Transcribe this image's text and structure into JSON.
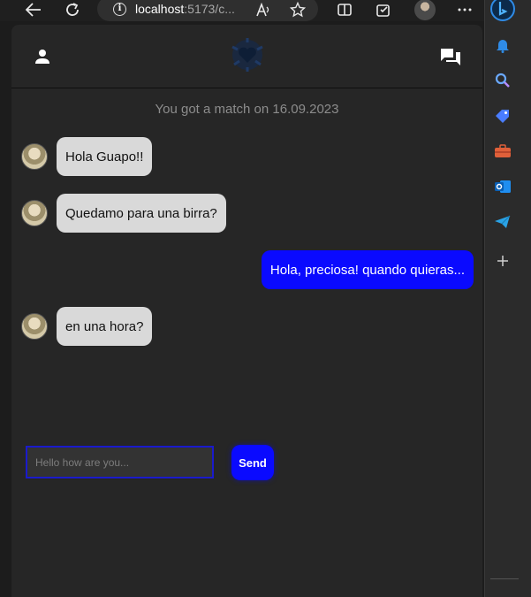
{
  "browser": {
    "address_host": "localhost",
    "address_rest": ":5173/c...",
    "info_icon_glyph": "i",
    "icons": [
      "back-icon",
      "refresh-icon",
      "info-icon",
      "read-aloud-icon",
      "favorite-star-icon",
      "split-screen-icon",
      "extensions-icon",
      "profile-avatar",
      "more-icon"
    ]
  },
  "sidebar": {
    "icons": [
      "bing-icon",
      "bell-icon",
      "search-icon",
      "tag-icon",
      "toolbox-icon",
      "outlook-icon",
      "telegram-icon",
      "add-icon"
    ]
  },
  "app": {
    "header_icons": [
      "user-icon",
      "logo-heart-icon",
      "chat-icon"
    ],
    "match_text": "You got a match on 16.09.2023",
    "messages": [
      {
        "direction": "incoming",
        "text": "Hola Guapo!!"
      },
      {
        "direction": "incoming",
        "text": "Quedamo para una birra?"
      },
      {
        "direction": "outgoing",
        "text": "Hola, preciosa! quando quieras..."
      },
      {
        "direction": "incoming",
        "text": "en una hora?"
      }
    ],
    "composer": {
      "placeholder": "Hello how are you...",
      "value": "",
      "send_label": "Send"
    }
  },
  "colors": {
    "background": "#262626",
    "incoming_bubble": "#d9d9d9",
    "outgoing_bubble": "#0a0aff",
    "accent": "#0a0aff",
    "logo": "#1f3a66"
  }
}
